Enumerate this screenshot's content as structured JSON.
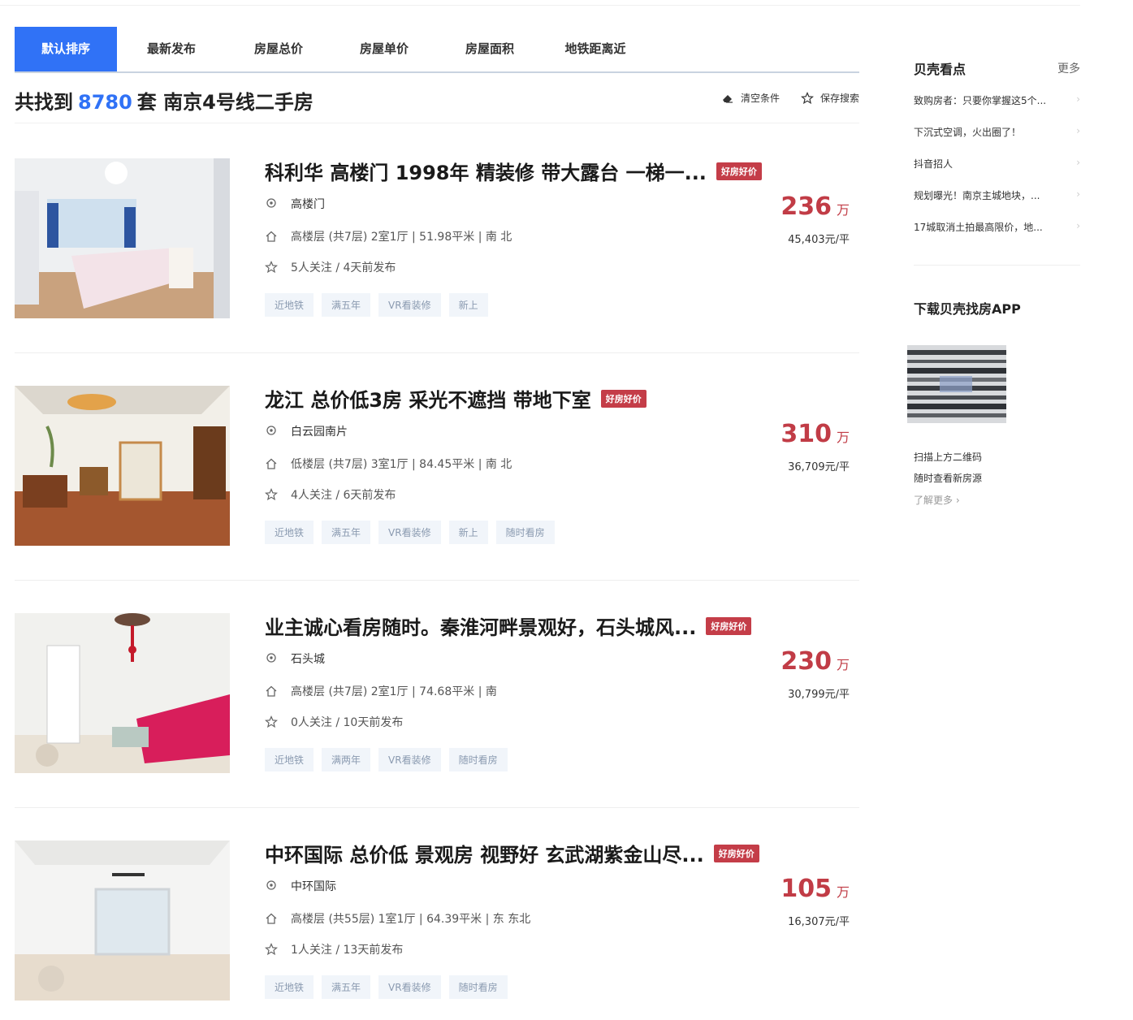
{
  "tabs": [
    "默认排序",
    "最新发布",
    "房屋总价",
    "房屋单价",
    "房屋面积",
    "地铁距离近"
  ],
  "result": {
    "prefix": "共找到",
    "count": "8780",
    "suffix": "套 南京4号线二手房",
    "clear_label": "清空条件",
    "save_label": "保存搜索"
  },
  "listings": [
    {
      "title": "科利华 高楼门 1998年 精装修 带大露台 一梯一...",
      "badge": "好房好价",
      "location": "高楼门",
      "house_info": "高楼层 (共7层) 2室1厅 | 51.98平米 | 南 北",
      "follow_info": "5人关注 / 4天前发布",
      "tags": [
        "近地铁",
        "满五年",
        "VR看装修",
        "新上"
      ],
      "total_price": "236",
      "price_unit": "万",
      "unit_price": "45,403元/平"
    },
    {
      "title": "龙江 总价低3房 采光不遮挡 带地下室",
      "badge": "好房好价",
      "location": "白云园南片",
      "house_info": "低楼层 (共7层) 3室1厅 | 84.45平米 | 南 北",
      "follow_info": "4人关注 / 6天前发布",
      "tags": [
        "近地铁",
        "满五年",
        "VR看装修",
        "新上",
        "随时看房"
      ],
      "total_price": "310",
      "price_unit": "万",
      "unit_price": "36,709元/平"
    },
    {
      "title": "业主诚心看房随时。秦淮河畔景观好，石头城风...",
      "badge": "好房好价",
      "location": "石头城",
      "house_info": "高楼层 (共7层) 2室1厅 | 74.68平米 | 南",
      "follow_info": "0人关注 / 10天前发布",
      "tags": [
        "近地铁",
        "满两年",
        "VR看装修",
        "随时看房"
      ],
      "total_price": "230",
      "price_unit": "万",
      "unit_price": "30,799元/平"
    },
    {
      "title": "中环国际 总价低 景观房 视野好 玄武湖紫金山尽...",
      "badge": "好房好价",
      "location": "中环国际",
      "house_info": "高楼层 (共55层) 1室1厅 | 64.39平米 | 东 东北",
      "follow_info": "1人关注 / 13天前发布",
      "tags": [
        "近地铁",
        "满五年",
        "VR看装修",
        "随时看房"
      ],
      "total_price": "105",
      "price_unit": "万",
      "unit_price": "16,307元/平"
    }
  ],
  "sidebar": {
    "title": "贝壳看点",
    "more": "更多",
    "news": [
      "致购房者：只要你掌握这5个...",
      "下沉式空调，火出圈了！",
      "抖音招人",
      "规划曝光！南京主城地块，...",
      "17城取消土拍最高限价，地..."
    ],
    "news_arrow": "›",
    "app_title": "下载贝壳找房APP",
    "qr_line1": "扫描上方二维码",
    "qr_line2": "随时查看新房源",
    "learn_more": "了解更多 ›"
  },
  "colors": {
    "accent": "#3072f6",
    "price": "#c13c46",
    "badge": "#c43d48",
    "tag_bg": "#f1f5fa"
  }
}
